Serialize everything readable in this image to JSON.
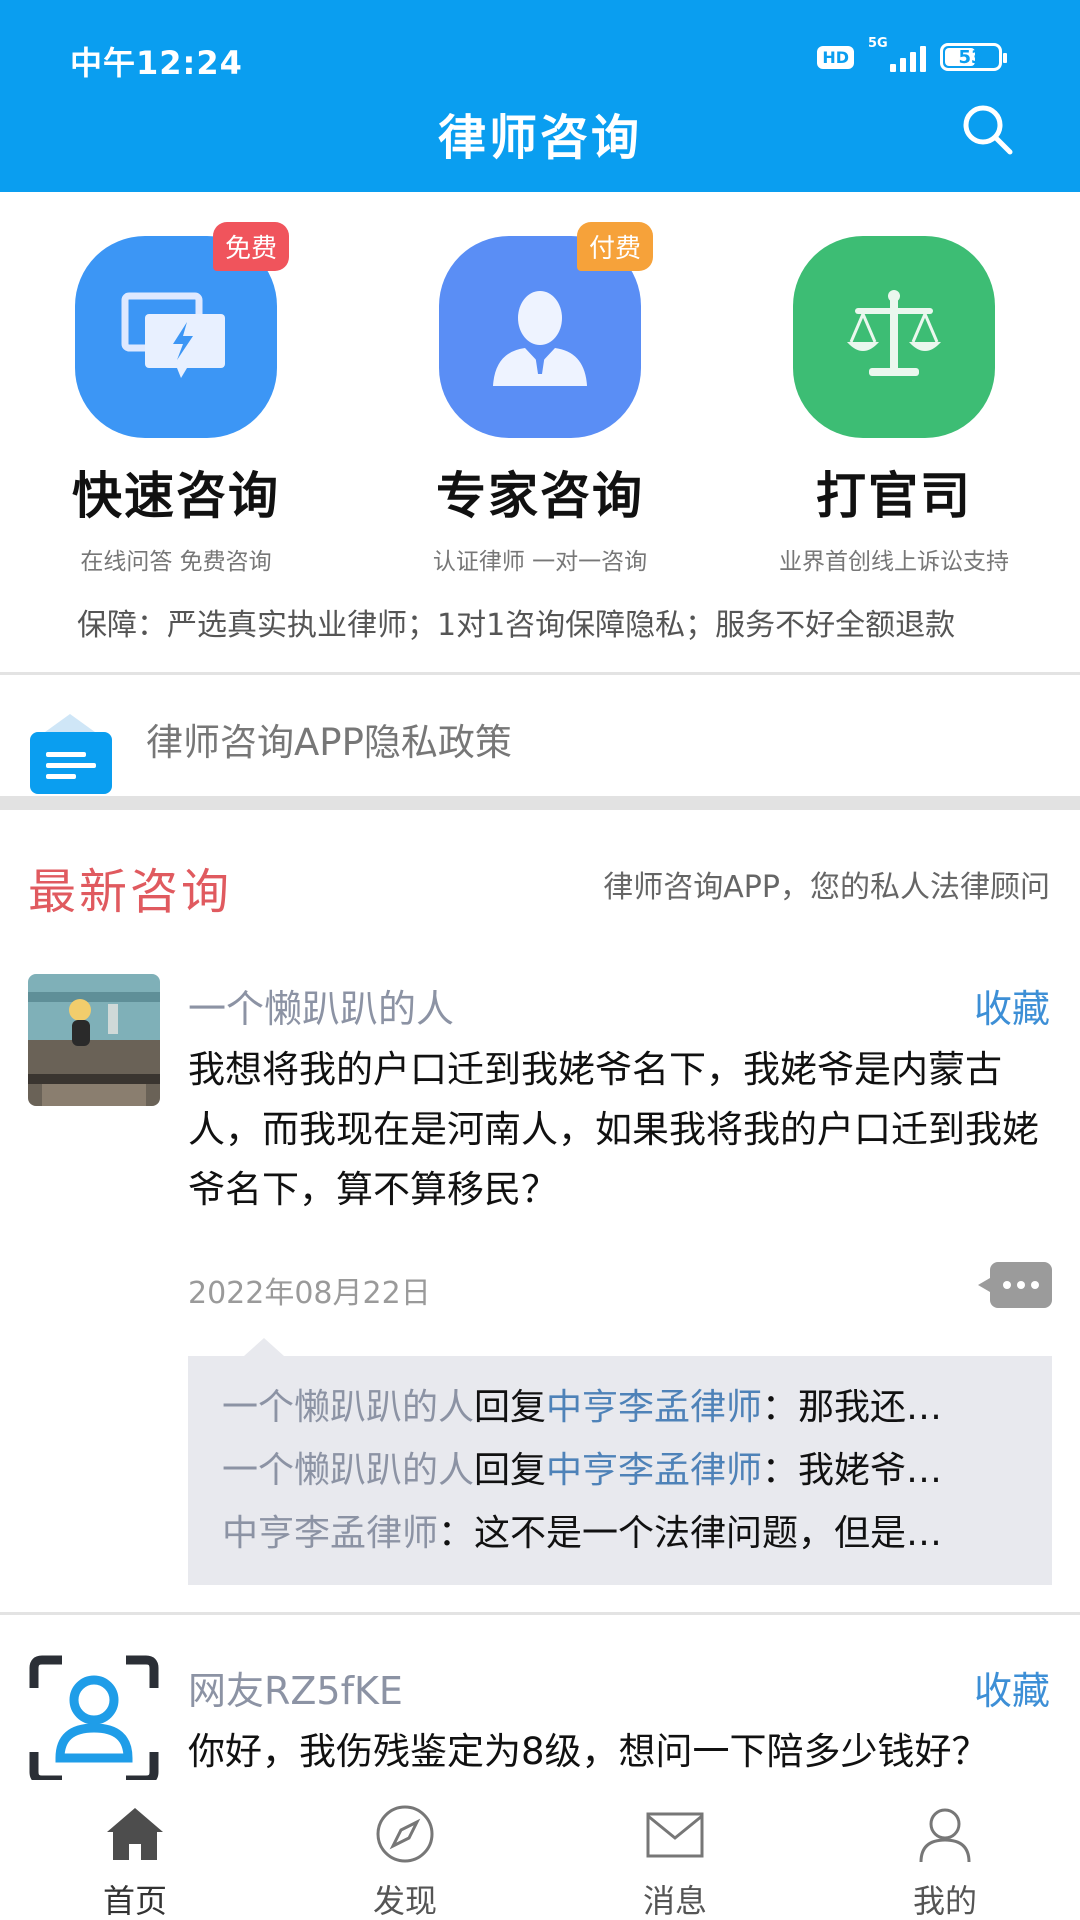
{
  "status_bar": {
    "time": "中午12:24",
    "hd": "HD",
    "network": "5G",
    "battery": "53",
    "battery_level": 0.53
  },
  "header": {
    "title": "律师咨询"
  },
  "services": [
    {
      "name": "快速咨询",
      "desc": "在线问答 免费咨询",
      "tag": "免费",
      "tag_color": "#f0545c",
      "color": "#3c96f5",
      "icon": "quick-chat-icon"
    },
    {
      "name": "专家咨询",
      "desc": "认证律师 一对一咨询",
      "tag": "付费",
      "tag_color": "#f6a23a",
      "color": "#5a8ef5",
      "icon": "lawyer-icon"
    },
    {
      "name": "打官司",
      "desc": "业界首创线上诉讼支持",
      "tag": "",
      "color": "#3dbd74",
      "icon": "scales-icon"
    }
  ],
  "guarantee": "保障：严选真实执业律师；1对1咨询保障隐私；服务不好全额退款",
  "notice": {
    "text": "律师咨询APP隐私政策"
  },
  "latest": {
    "title": "最新咨询",
    "slogan": "律师咨询APP，您的私人法律顾问"
  },
  "posts": [
    {
      "user": "一个懒趴趴的人",
      "fav": "收藏",
      "content": "我想将我的户口迁到我姥爷名下，我姥爷是内蒙古人，而我现在是河南人，如果我将我的户口迁到我姥爷名下，算不算移民？",
      "date": "2022年08月22日",
      "replies": [
        {
          "from": "一个懒趴趴的人",
          "verb": "回复",
          "to": "中亨李孟律师",
          "text": "：那我还…"
        },
        {
          "from": "一个懒趴趴的人",
          "verb": "回复",
          "to": "中亨李孟律师",
          "text": "：我姥爷…"
        },
        {
          "from": "中亨李孟律师",
          "verb": "",
          "to": "",
          "text": "：这不是一个法律问题，但是…"
        }
      ]
    },
    {
      "user": "网友RZ5fKE",
      "fav": "收藏",
      "content": "你好，我伤残鉴定为8级，想问一下陪多少钱好？"
    }
  ],
  "tabbar": [
    {
      "label": "首页",
      "icon": "home-icon",
      "active": true
    },
    {
      "label": "发现",
      "icon": "compass-icon",
      "active": false
    },
    {
      "label": "消息",
      "icon": "mail-icon",
      "active": false
    },
    {
      "label": "我的",
      "icon": "profile-icon",
      "active": false
    }
  ]
}
